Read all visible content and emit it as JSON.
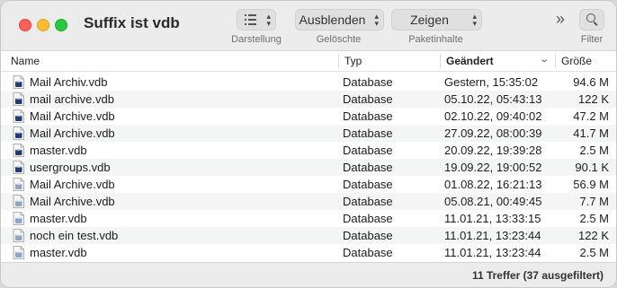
{
  "window": {
    "title": "Suffix ist vdb"
  },
  "toolbar": {
    "view_caption": "Darstellung",
    "deleted_select": "Ausblenden",
    "deleted_caption": "Gelöschte",
    "package_select": "Zeigen",
    "package_caption": "Paketinhalte",
    "more_glyph": "»",
    "filter_caption": "Filter"
  },
  "columns": {
    "name": "Name",
    "type": "Typ",
    "modified": "Geändert",
    "size": "Größe"
  },
  "files": [
    {
      "name": "Mail Archiv.vdb",
      "type": "Database",
      "modified": "Gestern, 15:35:02",
      "size": "94.6 M",
      "icon": "dark"
    },
    {
      "name": "mail archive.vdb",
      "type": "Database",
      "modified": "05.10.22, 05:43:13",
      "size": "122 K",
      "icon": "dark"
    },
    {
      "name": "Mail Archive.vdb",
      "type": "Database",
      "modified": "02.10.22, 09:40:02",
      "size": "47.2 M",
      "icon": "dark"
    },
    {
      "name": "Mail Archive.vdb",
      "type": "Database",
      "modified": "27.09.22, 08:00:39",
      "size": "41.7 M",
      "icon": "dark"
    },
    {
      "name": "master.vdb",
      "type": "Database",
      "modified": "20.09.22, 19:39:28",
      "size": "2.5 M",
      "icon": "dark"
    },
    {
      "name": "usergroups.vdb",
      "type": "Database",
      "modified": "19.09.22, 19:00:52",
      "size": "90.1 K",
      "icon": "dark"
    },
    {
      "name": "Mail Archive.vdb",
      "type": "Database",
      "modified": "01.08.22, 16:21:13",
      "size": "56.9 M",
      "icon": "light"
    },
    {
      "name": "Mail Archive.vdb",
      "type": "Database",
      "modified": "05.08.21, 00:49:45",
      "size": "7.7 M",
      "icon": "light"
    },
    {
      "name": "master.vdb",
      "type": "Database",
      "modified": "11.01.21, 13:33:15",
      "size": "2.5 M",
      "icon": "light"
    },
    {
      "name": "noch ein test.vdb",
      "type": "Database",
      "modified": "11.01.21, 13:23:44",
      "size": "122 K",
      "icon": "light"
    },
    {
      "name": "master.vdb",
      "type": "Database",
      "modified": "11.01.21, 13:23:44",
      "size": "2.5 M",
      "icon": "light"
    }
  ],
  "status": "11 Treffer (37 ausgefiltert)",
  "colors": {
    "icon_dark": "#1f3c78",
    "icon_light": "#8ea4c8",
    "row_alt": "#f4f5f5"
  }
}
